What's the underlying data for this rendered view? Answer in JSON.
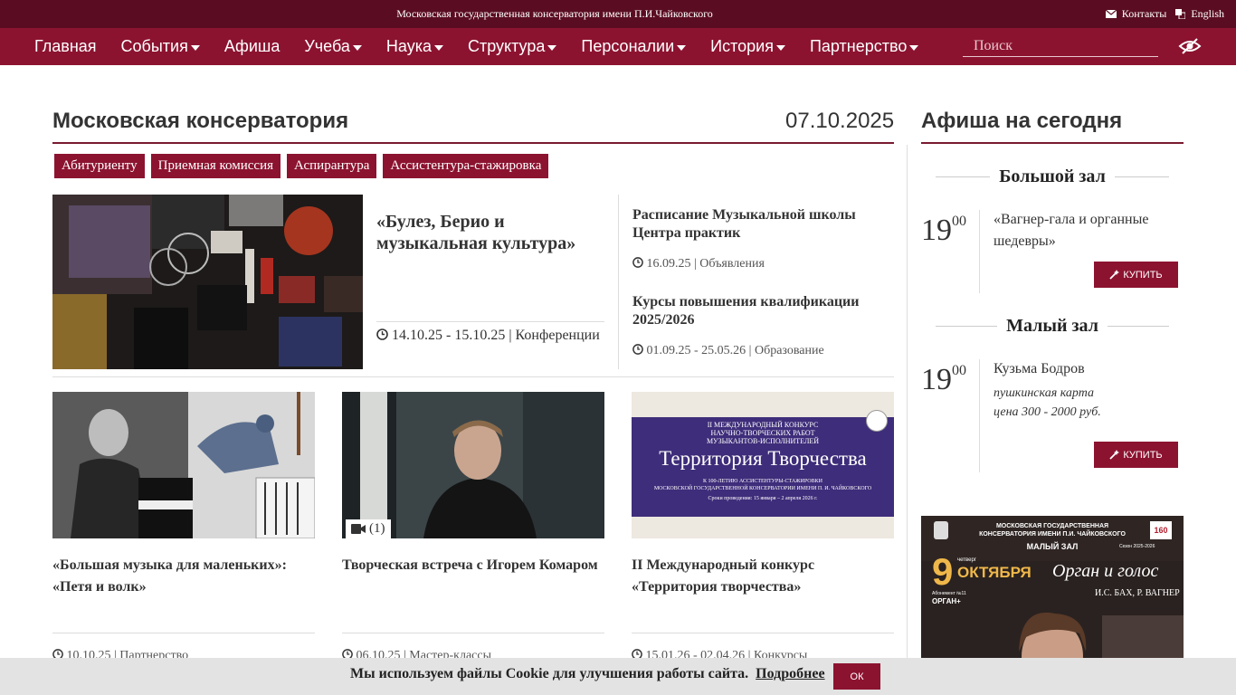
{
  "topbar": {
    "org_name": "Московская государственная консерватория имени П.И.Чайковского",
    "contacts": "Контакты",
    "language": "English"
  },
  "nav": {
    "items": [
      {
        "label": "Главная",
        "dropdown": false
      },
      {
        "label": "События",
        "dropdown": true
      },
      {
        "label": "Афиша",
        "dropdown": false
      },
      {
        "label": "Учеба",
        "dropdown": true
      },
      {
        "label": "Наука",
        "dropdown": true
      },
      {
        "label": "Структура",
        "dropdown": true
      },
      {
        "label": "Персоналии",
        "dropdown": true
      },
      {
        "label": "История",
        "dropdown": true
      },
      {
        "label": "Партнерство",
        "dropdown": true
      }
    ],
    "search_placeholder": "Поиск"
  },
  "main": {
    "title": "Московская консерватория",
    "date": "07.10.2025",
    "tags": [
      "Абитуриенту",
      "Приемная комиссия",
      "Аспирантура",
      "Ассистентура-стажировка"
    ],
    "featured": {
      "title": "«Булез, Берио и музыкальная культура»",
      "meta": "14.10.25 - 15.10.25 | Конференции"
    },
    "news": [
      {
        "title": "Расписание Музыкальной школы Центра практик",
        "meta": "16.09.25 | Объявления"
      },
      {
        "title": "Курсы повышения квалификации 2025/2026",
        "meta": "01.09.25 - 25.05.26 | Образование"
      }
    ],
    "cards": [
      {
        "title": "«Большая музыка для маленьких»: «Петя и волк»",
        "meta": "10.10.25 | Партнерство"
      },
      {
        "title": "Творческая встреча с Игорем Комаром",
        "meta": "06.10.25 | Мастер-классы",
        "video_count": "(1)"
      },
      {
        "title": "II Международный конкурс «Территория творчества»",
        "meta": "15.01.26 - 02.04.26 | Конкурсы",
        "banner": {
          "line1": "II МЕЖДУНАРОДНЫЙ КОНКУРС",
          "line2": "НАУЧНО-ТВОРЧЕСКИХ РАБОТ",
          "line3": "МУЗЫКАНТОВ-ИСПОЛНИТЕЛЕЙ",
          "big": "Территория Творчества",
          "sub1": "К 100-ЛЕТИЮ АССИСТЕНТУРЫ-СТАЖИРОВКИ",
          "sub2": "МОСКОВСКОЙ ГОСУДАРСТВЕННОЙ КОНСЕРВАТОРИИ ИМЕНИ П. И. ЧАЙКОВСКОГО",
          "dates": "Сроки проведения: 15 января – 2 апреля 2026 г."
        }
      }
    ]
  },
  "sidebar": {
    "title": "Афиша на сегодня",
    "halls": [
      {
        "name": "Большой зал",
        "hour": "19",
        "minutes": "00",
        "event": "«Вагнер-гала и органные шедевры»",
        "buy": "КУПИТЬ"
      },
      {
        "name": "Малый зал",
        "hour": "19",
        "minutes": "00",
        "event": "Кузьма Бодров",
        "note1": "пушкинская карта",
        "note2": "цена 300 - 2000 руб.",
        "buy": "КУПИТЬ"
      }
    ],
    "poster": {
      "org1": "МОСКОВСКАЯ ГОСУДАРСТВЕННАЯ",
      "org2": "КОНСЕРВАТОРИЯ ИМЕНИ П.И. ЧАЙКОВСКОГО",
      "hall": "МАЛЫЙ ЗАЛ",
      "season": "Сезон 2025-2026",
      "day": "9",
      "weekday": "четверг",
      "month": "ОКТЯБРЯ",
      "title": "Орган и голос",
      "composers": "И.С. БАХ, Р. ВАГНЕР",
      "subscription": "Абонемент №11",
      "subscription_name": "ОРГАН+",
      "badge": "160"
    }
  },
  "cookie": {
    "message": "Мы используем файлы Cookie для улучшения работы сайта.",
    "more": "Подробнее",
    "ok": "ОК"
  },
  "colors": {
    "topbar": "#5a0d22",
    "accent": "#8c1330"
  }
}
